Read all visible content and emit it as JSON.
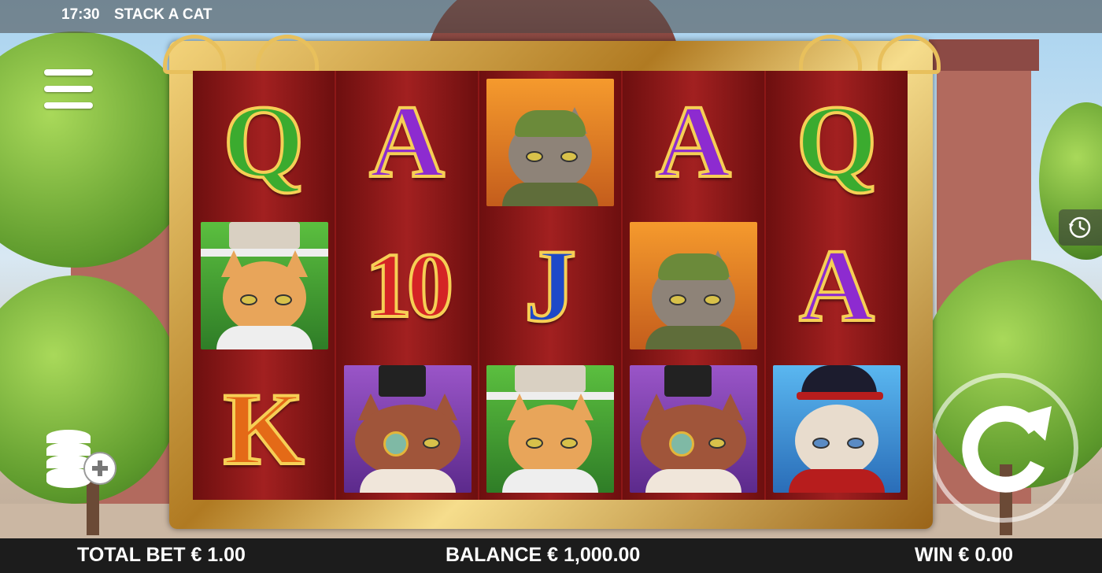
{
  "status_bar": {
    "time": "17:30",
    "game_title": "STACK A CAT"
  },
  "reels": [
    [
      "Q",
      "cat-top-hat",
      "K"
    ],
    [
      "A",
      "10",
      "cat-monocle"
    ],
    [
      "cat-flat-cap",
      "J",
      "cat-top-hat"
    ],
    [
      "A",
      "cat-flat-cap",
      "cat-monocle"
    ],
    [
      "Q",
      "A",
      "cat-bowler"
    ]
  ],
  "bottom_bar": {
    "total_bet": "TOTAL BET € 1.00",
    "balance": "BALANCE € 1,000.00",
    "win": "WIN € 0.00"
  },
  "controls": {
    "menu_icon": "hamburger-menu-icon",
    "history_icon": "clock-history-icon",
    "bet_icon": "coins-plus-icon",
    "spin_icon": "spin-arrow-icon"
  },
  "colors": {
    "reel_background": "#8d1717",
    "frame_gold": "#d9a73c",
    "bottom_bar": "#1c1c1c"
  }
}
